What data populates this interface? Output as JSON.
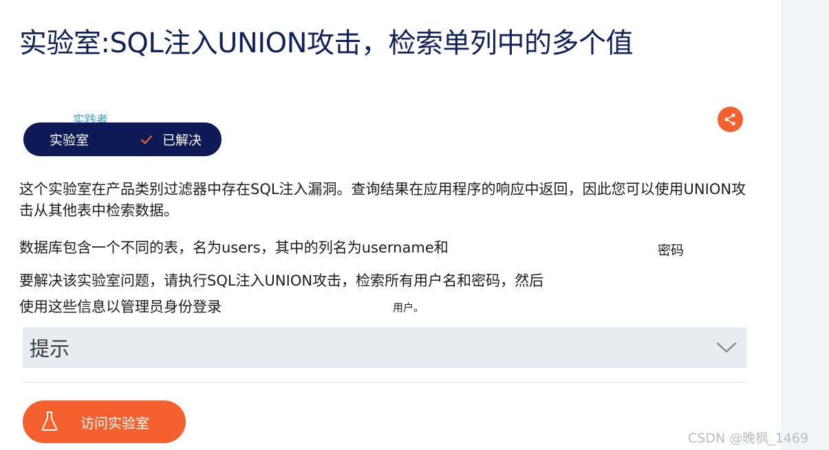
{
  "page": {
    "title": "实验室:SQL注入UNION攻击，检索单列中的多个值"
  },
  "lab_meta": {
    "level": "实践者",
    "badge_label": "实验室",
    "status": "已解决"
  },
  "description": {
    "p1": "这个实验室在产品类别过滤器中存在SQL注入漏洞。查询结果在应用程序的响应中返回，因此您可以使用UNION攻击从其他表中检索数据。",
    "p2": "数据库包含一个不同的表，名为users，其中的列名为username和",
    "p2_tail": "密码",
    "p3": "要解决该实验室问题，请执行SQL注入UNION攻击，检索所有用户名和密码，然后",
    "p4": "使用这些信息以管理员身份登录",
    "p4_tail": "用户。"
  },
  "hint": {
    "label": "提示"
  },
  "actions": {
    "access_lab": "访问实验室"
  },
  "watermark": "CSDN @晚枫_1469",
  "colors": {
    "title": "#10215a",
    "pill_bg": "#0d1a55",
    "accent": "#f4612e",
    "hint_bg": "#e8ecf0"
  },
  "icons": {
    "share": "share-icon",
    "check": "check-icon",
    "chevron": "chevron-down-icon",
    "flask": "flask-icon"
  }
}
